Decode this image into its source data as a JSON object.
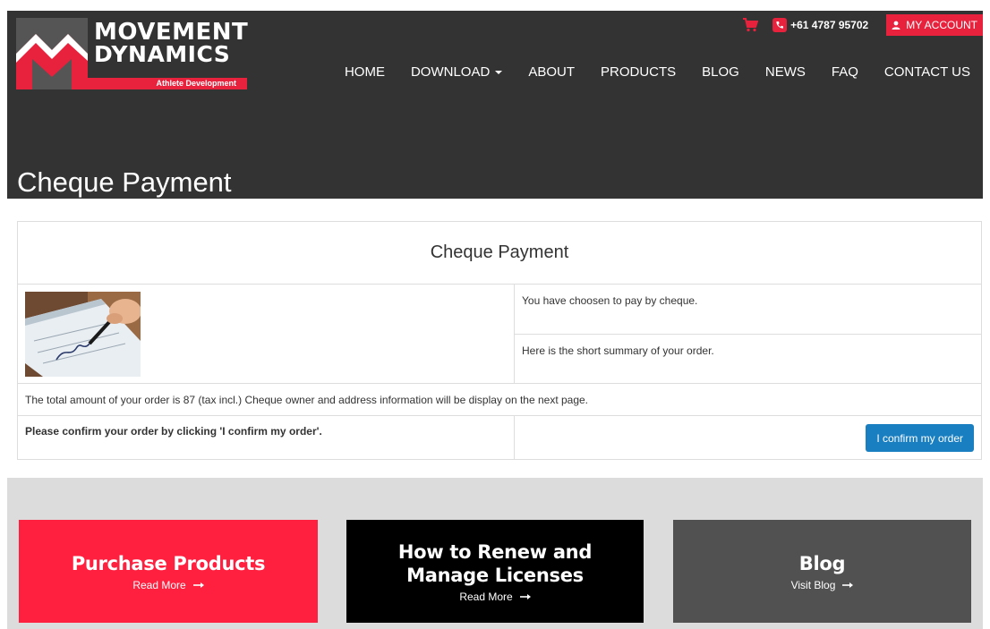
{
  "brand": {
    "name_line1": "MOVEMENT",
    "name_line2": "DYNAMICS",
    "tagline": "Athlete Development",
    "accent_color": "#e8213d"
  },
  "topbar": {
    "cart_icon": "cart-icon",
    "phone": "+61 4787 95702",
    "account_label": "MY ACCOUNT"
  },
  "nav": {
    "items": [
      {
        "label": "HOME"
      },
      {
        "label": "DOWNLOAD"
      },
      {
        "label": "ABOUT"
      },
      {
        "label": "PRODUCTS"
      },
      {
        "label": "BLOG"
      },
      {
        "label": "NEWS"
      },
      {
        "label": "FAQ"
      },
      {
        "label": "CONTACT US"
      }
    ]
  },
  "page": {
    "title": "Cheque Payment"
  },
  "payment": {
    "heading": "Cheque Payment",
    "chosen_text": "You have choosen to pay by cheque.",
    "summary_text": "Here is the short summary of your order.",
    "total_text": "The total amount of your order is 87 (tax incl.) Cheque owner and address information will be display on the next page.",
    "confirm_prompt": "Please confirm your order by clicking 'I confirm my order'.",
    "confirm_button": "I confirm my order",
    "button_color": "#1a7fc1"
  },
  "footer": {
    "cards": [
      {
        "title": "Purchase Products",
        "link": "Read More",
        "color": "#ff2040"
      },
      {
        "title_line1": "How to Renew and",
        "title_line2": "Manage Licenses",
        "link": "Read More",
        "color": "#000000"
      },
      {
        "title": "Blog",
        "link": "Visit Blog",
        "color": "#515151"
      }
    ]
  }
}
